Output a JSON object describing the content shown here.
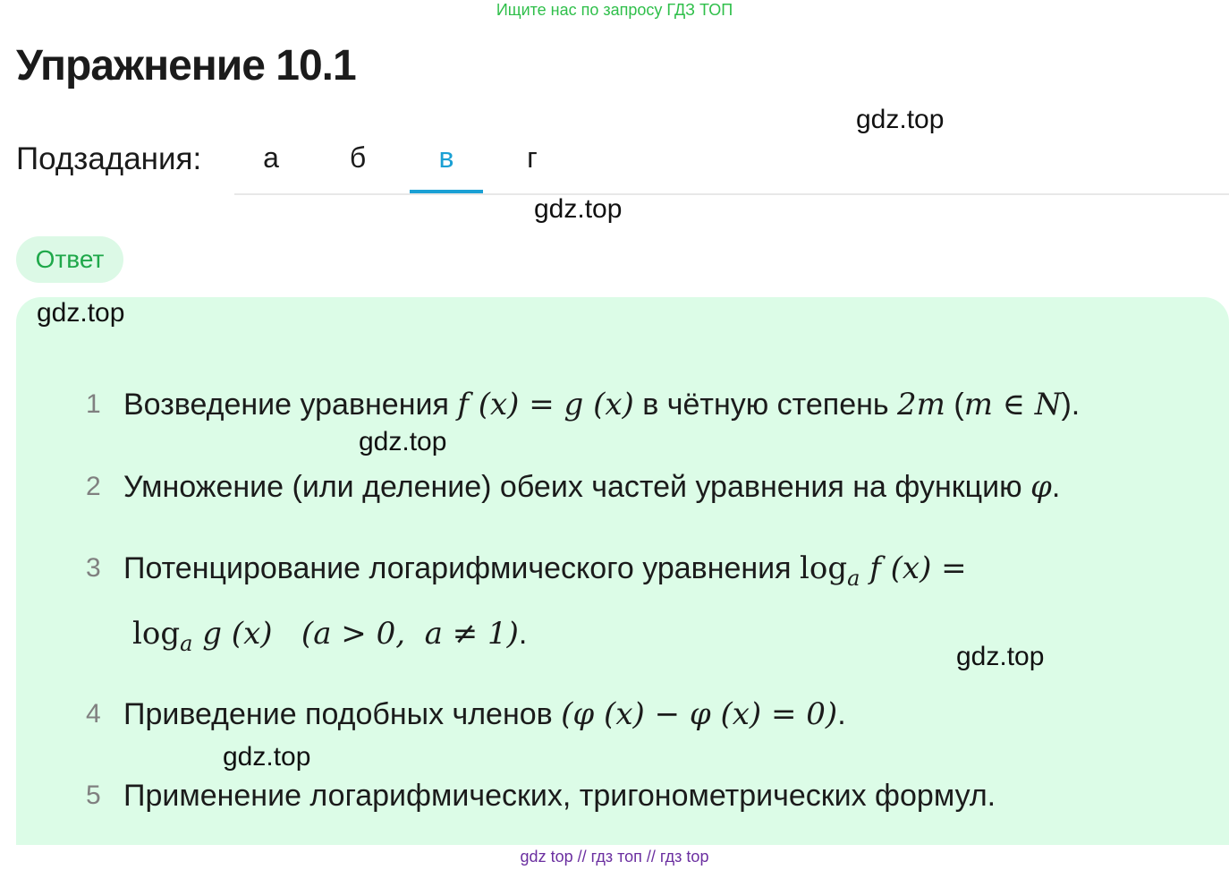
{
  "promo": "Ищите нас по запросу ГДЗ ТОП",
  "title": "Упражнение 10.1",
  "subtasks_label": "Подзадания:",
  "tabs": [
    {
      "label": "а",
      "active": false
    },
    {
      "label": "б",
      "active": false
    },
    {
      "label": "в",
      "active": true
    },
    {
      "label": "г",
      "active": false
    }
  ],
  "answer_button": "Ответ",
  "watermark": "gdz.top",
  "items": [
    {
      "num": "1",
      "pre": "Возведение уравнения ",
      "math1": "f (x) = g (x)",
      "mid": " в чётную степень ",
      "math2": "2m",
      "post": " (",
      "math3": "m ∈ N",
      "end": ")."
    },
    {
      "num": "2",
      "pre": "Умножение (или деление) обеих частей уравнения на функцию ",
      "math1": "φ",
      "end": "."
    },
    {
      "num": "3",
      "pre": "Потенцирование логарифмического уравнения ",
      "math1": "log",
      "sub1": "a",
      "math1b": " f (x) =",
      "line2_a": "log",
      "line2_sub": "a",
      "line2_b": " g (x)   (a > 0,  a ≠ 1)",
      "end": "."
    },
    {
      "num": "4",
      "pre": "Приведение подобных членов ",
      "math1": "(φ (x) − φ (x) = 0)",
      "end": "."
    },
    {
      "num": "5",
      "pre": "Применение логарифмических, тригонометрических формул."
    }
  ],
  "bottom_links": "gdz top  //  гдз топ  //  гдз top",
  "colors": {
    "accent": "#1aa0d4",
    "panel": "#dcfce7",
    "promo": "#2fbf4a",
    "links": "#6b2fa0"
  }
}
